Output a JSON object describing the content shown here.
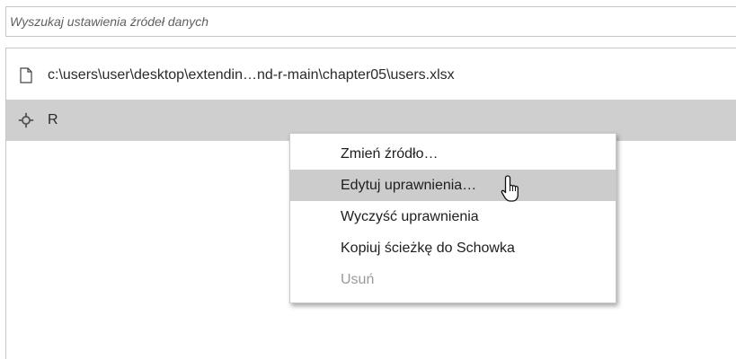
{
  "search": {
    "placeholder": "Wyszukaj ustawienia źródeł danych"
  },
  "sources": [
    {
      "icon": "file-icon",
      "label": "c:\\users\\user\\desktop\\extendin…nd-r-main\\chapter05\\users.xlsx"
    },
    {
      "icon": "r-connector-icon",
      "label": "R"
    }
  ],
  "context_menu": {
    "items": [
      {
        "label": "Zmień źródło…",
        "state": "normal"
      },
      {
        "label": "Edytuj uprawnienia…",
        "state": "hover"
      },
      {
        "label": "Wyczyść uprawnienia",
        "state": "normal"
      },
      {
        "label": "Kopiuj ścieżkę do Schowka",
        "state": "normal"
      },
      {
        "label": "Usuń",
        "state": "disabled"
      }
    ]
  },
  "colors": {
    "selected_row": "#cfcfcf",
    "hover_item": "#cccccc",
    "disabled_text": "#9a9a9a"
  }
}
